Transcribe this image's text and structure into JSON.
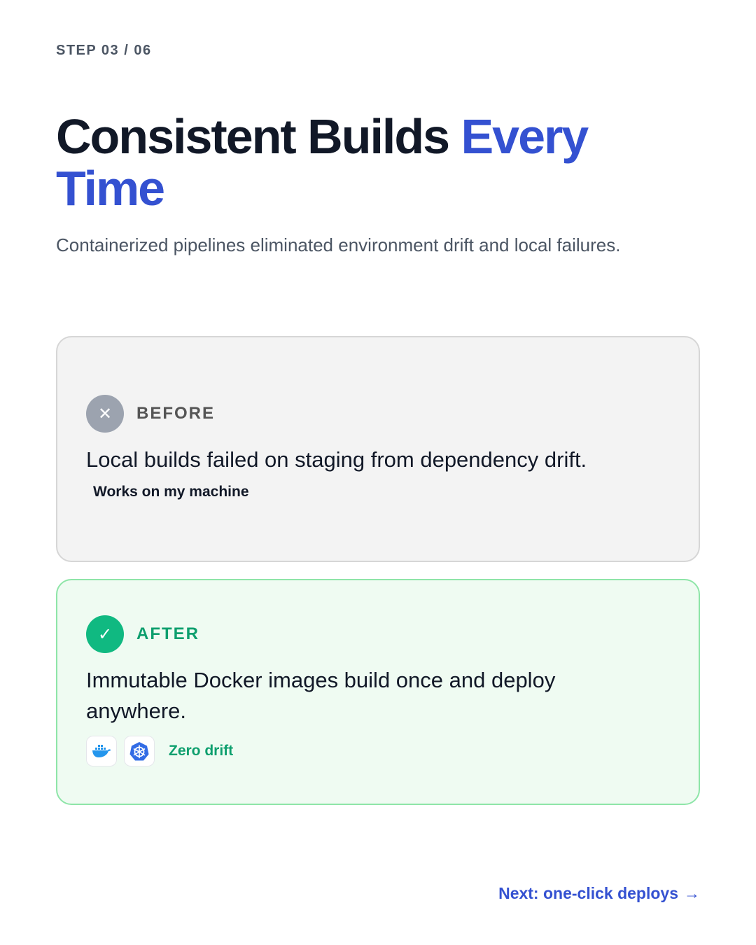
{
  "step": "STEP 03 / 06",
  "title": {
    "main": "Consistent Builds ",
    "accent": "Every Time"
  },
  "subtitle": "Containerized pipelines eliminated environment drift and local failures.",
  "before": {
    "label": "BEFORE",
    "icon": "close-icon",
    "badge_glyph": "✕",
    "text": "Local builds failed on staging from dependency drift.",
    "tag": "Works on my machine"
  },
  "after": {
    "label": "AFTER",
    "icon": "check-icon",
    "badge_glyph": "✓",
    "text": "Immutable Docker images build once and deploy anywhere.",
    "logos": [
      "docker-icon",
      "kubernetes-icon"
    ],
    "tag": "Zero drift"
  },
  "next": {
    "label": "Next: one-click deploys",
    "arrow": "→"
  },
  "colors": {
    "accent": "#3451d1",
    "success": "#10b981",
    "success_text": "#0e9f6e",
    "muted": "#9ca3af"
  }
}
